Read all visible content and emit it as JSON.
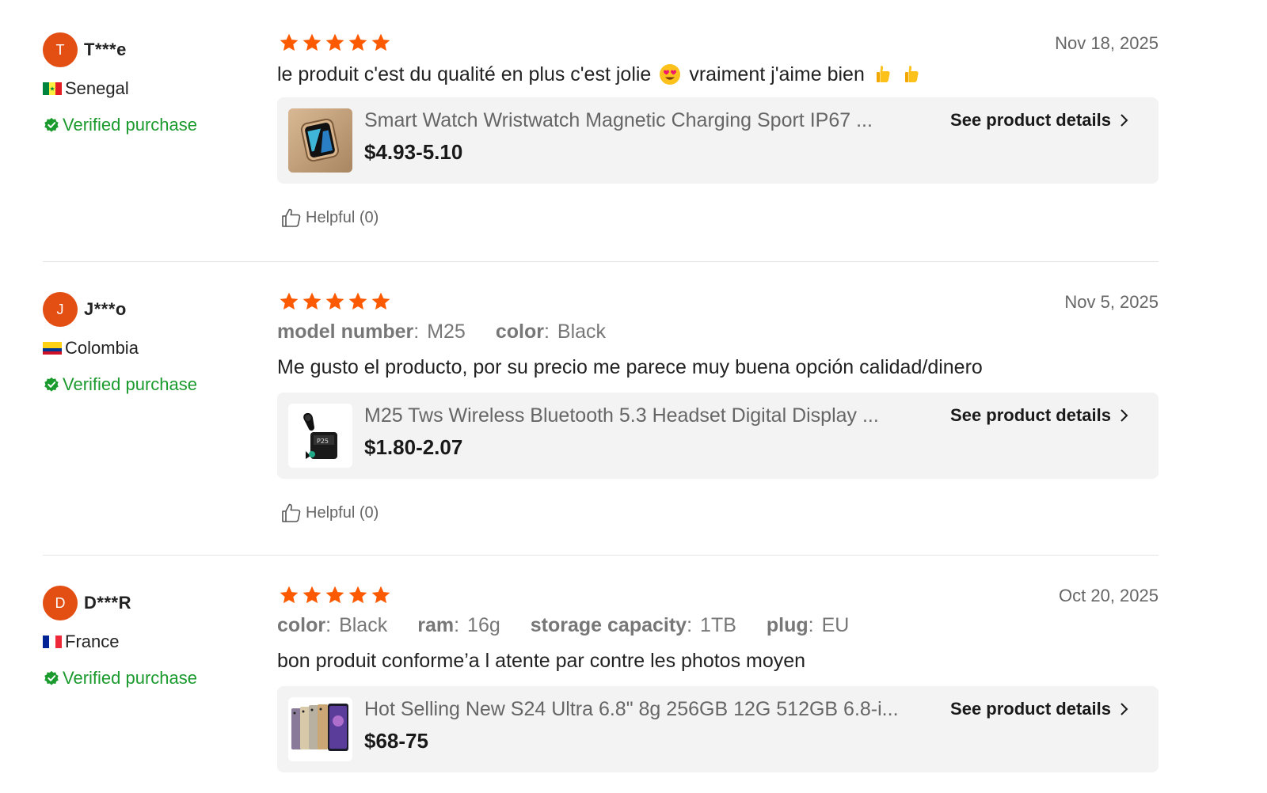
{
  "colors": {
    "accent_orange": "#fd5a00",
    "avatar_bg": "#e34e12",
    "verified_green": "#1b9a2e",
    "card_bg": "#f3f3f3",
    "divider": "#e5e5e5"
  },
  "reviews": [
    {
      "avatar_initial": "T",
      "username": "T***e",
      "country": "Senegal",
      "flag_icon": "senegal-flag-icon",
      "verified_text": "Verified purchase",
      "rating": 5,
      "date": "Nov 18, 2025",
      "attributes": [],
      "text_parts": [
        "le produit c'est du qualité en plus c'est jolie",
        "vraiment j'aime bien"
      ],
      "emojis": [
        "smiling-face-with-heart-eyes-emoji",
        "thumbs-up-emoji",
        "thumbs-up-emoji"
      ],
      "product": {
        "title": "Smart Watch Wristwatch Magnetic Charging Sport IP67 ...",
        "price": "$4.93-5.10",
        "details_label": "See product details",
        "thumb_icon": "smart-watch-thumbnail"
      },
      "helpful_label": "Helpful (0)"
    },
    {
      "avatar_initial": "J",
      "username": "J***o",
      "country": "Colombia",
      "flag_icon": "colombia-flag-icon",
      "verified_text": "Verified purchase",
      "rating": 5,
      "date": "Nov 5, 2025",
      "attributes": [
        {
          "key": "model number",
          "value": "M25"
        },
        {
          "key": "color",
          "value": "Black"
        }
      ],
      "text": "Me gusto el producto, por su precio me parece muy buena opción calidad/dinero",
      "product": {
        "title": "M25 Tws Wireless Bluetooth 5.3 Headset Digital Display ...",
        "price": "$1.80-2.07",
        "details_label": "See product details",
        "thumb_icon": "wireless-earbuds-thumbnail"
      },
      "helpful_label": "Helpful (0)"
    },
    {
      "avatar_initial": "D",
      "username": "D***R",
      "country": "France",
      "flag_icon": "france-flag-icon",
      "verified_text": "Verified purchase",
      "rating": 5,
      "date": "Oct 20, 2025",
      "attributes": [
        {
          "key": "color",
          "value": "Black"
        },
        {
          "key": "ram",
          "value": "16g"
        },
        {
          "key": "storage capacity",
          "value": "1TB"
        },
        {
          "key": "plug",
          "value": "EU"
        }
      ],
      "text": "bon produit conforme’a l atente par contre les photos moyen",
      "product": {
        "title": "Hot Selling New S24 Ultra 6.8\" 8g 256GB 12G 512GB 6.8-i...",
        "price": "$68-75",
        "details_label": "See product details",
        "thumb_icon": "smartphones-thumbnail"
      }
    }
  ],
  "attr_separator": ":"
}
